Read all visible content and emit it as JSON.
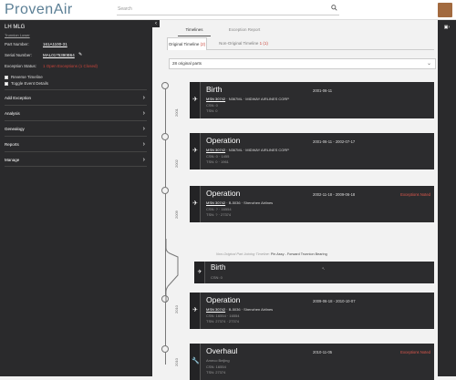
{
  "app": {
    "logo": "ProvenAir"
  },
  "search": {
    "placeholder": "Search"
  },
  "sidebar": {
    "title": "LH MLG",
    "subtitle": "Trunnion Lower",
    "fields": [
      {
        "label": "Part Number:",
        "value": "161A1100-31"
      },
      {
        "label": "Serial Number:",
        "value": "MAL0175390B64"
      },
      {
        "label": "Exception Status:",
        "value": "1 Open Exceptions (1 Closed)"
      }
    ],
    "checks": [
      "Reverse Timeline",
      "Toggle Event Details"
    ],
    "sections": [
      "Add Exception",
      "Analysis",
      "Genealogy",
      "Reports",
      "Manage"
    ]
  },
  "tabs": {
    "timelines": "Timelines",
    "exception_report": "Exception Report"
  },
  "subtabs": {
    "original_label": "Original Timeline",
    "original_count": "(2)",
    "non_original_label": "Non-Original Timeline",
    "non_original_count": "1 (1)"
  },
  "filter": {
    "value": "28 original parts"
  },
  "timeline": {
    "years": [
      "2001",
      "2002",
      "2009",
      "2010",
      "2010"
    ],
    "cards": [
      {
        "title": "Birth",
        "msn": "MSN 30742",
        "reg": "N367ML",
        "operator": "MIDWAY AIRLINES CORP",
        "csn": "CSN:  0",
        "tsn": "TSN:  0",
        "dates": "2001-06-11",
        "exception": ""
      },
      {
        "title": "Operation",
        "msn": "MSN 30742",
        "reg": "N367ML",
        "operator": "MIDWAY AIRLINES CORP",
        "csn": "CSN:  0  ·  1455",
        "tsn": "TSN:  0  ·  1961",
        "dates": "2001-06-11  -  2002-07-17",
        "exception": ""
      },
      {
        "title": "Operation",
        "msn": "MSN 30742",
        "reg": "B-5036",
        "operator": "Shenzhen Airlines",
        "csn": "CSN:  ?  ·  16554",
        "tsn": "TSN:  ?  ·  27374",
        "dates": "2002-11-18  -  2009-06-18",
        "exception": "Exceptions Noted"
      },
      {
        "title": "Operation",
        "msn": "MSN 30742",
        "reg": "B-5036",
        "operator": "Shenzhen Airlines",
        "csn": "CSN:  16554  ·  16554",
        "tsn": "TSN:  27374  ·  27374",
        "dates": "2009-06-18  -  2010-10-07",
        "exception": ""
      },
      {
        "title": "Overhaul",
        "msn": "Ameco Beijing",
        "reg": "",
        "operator": "",
        "csn": "CSN:  16554",
        "tsn": "TSN:  27374",
        "dates": "2010-11-05",
        "exception": "Exceptions Noted"
      }
    ],
    "note_prefix": "Non-Original Part Joining Timeline:",
    "note_part": "Pin Assy - Forward Trunnion Bearing",
    "alt_card": {
      "title": "Birth",
      "csn": "CSN:  0"
    }
  }
}
